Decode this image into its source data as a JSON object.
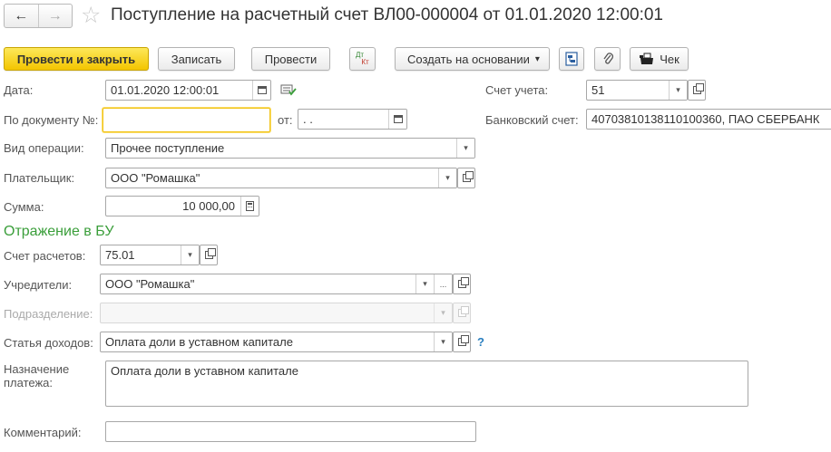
{
  "window": {
    "title": "Поступление на расчетный счет ВЛ00-000004 от 01.01.2020 12:00:01",
    "back_icon": "←",
    "forward_icon": "→",
    "favorite_icon": "☆"
  },
  "toolbar": {
    "post_close_label": "Провести и закрыть",
    "save_label": "Записать",
    "post_label": "Провести",
    "dtkt_top": "Дт",
    "dtkt_bottom": "Кт",
    "create_based_label": "Создать на основании",
    "dropdown_arrow": "▾",
    "check_label": "Чек"
  },
  "form": {
    "date_label": "Дата:",
    "date_value": "01.01.2020 12:00:01",
    "doc_number_label": "По документу №:",
    "doc_number_value": "",
    "from_label": "от:",
    "from_value": " .  .",
    "operation_label": "Вид операции:",
    "operation_value": "Прочее поступление",
    "payer_label": "Плательщик:",
    "payer_value": "ООО \"Ромашка\"",
    "amount_label": "Сумма:",
    "amount_value": "10 000,00",
    "account_label": "Счет учета:",
    "account_value": "51",
    "bank_account_label": "Банковский счет:",
    "bank_account_value": "40703810138110100360, ПАО СБЕРБАНК"
  },
  "accounting": {
    "section_title": "Отражение в БУ",
    "settlement_label": "Счет расчетов:",
    "settlement_value": "75.01",
    "founders_label": "Учредители:",
    "founders_value": "ООО \"Ромашка\"",
    "ellipsis": "...",
    "department_label": "Подразделение:",
    "department_value": "",
    "income_label": "Статья доходов:",
    "income_value": "Оплата доли в уставном капитале",
    "help": "?",
    "purpose_label_line1": "Назначение",
    "purpose_label_line2": "платежа:",
    "purpose_value": "Оплата доли в уставном капитале",
    "comment_label": "Комментарий:",
    "comment_value": ""
  },
  "colors": {
    "primary_button": "#f3c500",
    "section_title": "#3a9e3a",
    "focus_border": "#f2c318",
    "help": "#2a7fbf"
  },
  "icons": {
    "structure": "document-structure-icon",
    "attach": "paperclip-icon",
    "receipt": "cash-register-icon",
    "calendar": "calendar-icon",
    "calculator": "calculator-icon",
    "open": "open-form-icon",
    "list_check": "list-check-icon"
  }
}
